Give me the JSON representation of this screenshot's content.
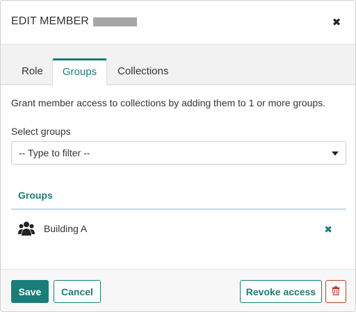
{
  "dialog": {
    "title": "EDIT MEMBER",
    "close_icon": "close-icon"
  },
  "tabs": [
    {
      "label": "Role",
      "active": false
    },
    {
      "label": "Groups",
      "active": true
    },
    {
      "label": "Collections",
      "active": false
    }
  ],
  "groups_tab": {
    "description": "Grant member access to collections by adding them to 1 or more groups.",
    "select_label": "Select groups",
    "select_placeholder": "-- Type to filter --",
    "table_header": "Groups",
    "rows": [
      {
        "name": "Building A",
        "icon": "users-icon",
        "remove_icon": "remove-icon"
      }
    ]
  },
  "footer": {
    "save_label": "Save",
    "cancel_label": "Cancel",
    "revoke_label": "Revoke access",
    "delete_icon": "trash-icon"
  },
  "colors": {
    "accent": "#1a7d77",
    "danger": "#c0392b",
    "redaction": "#a6a6a6"
  }
}
